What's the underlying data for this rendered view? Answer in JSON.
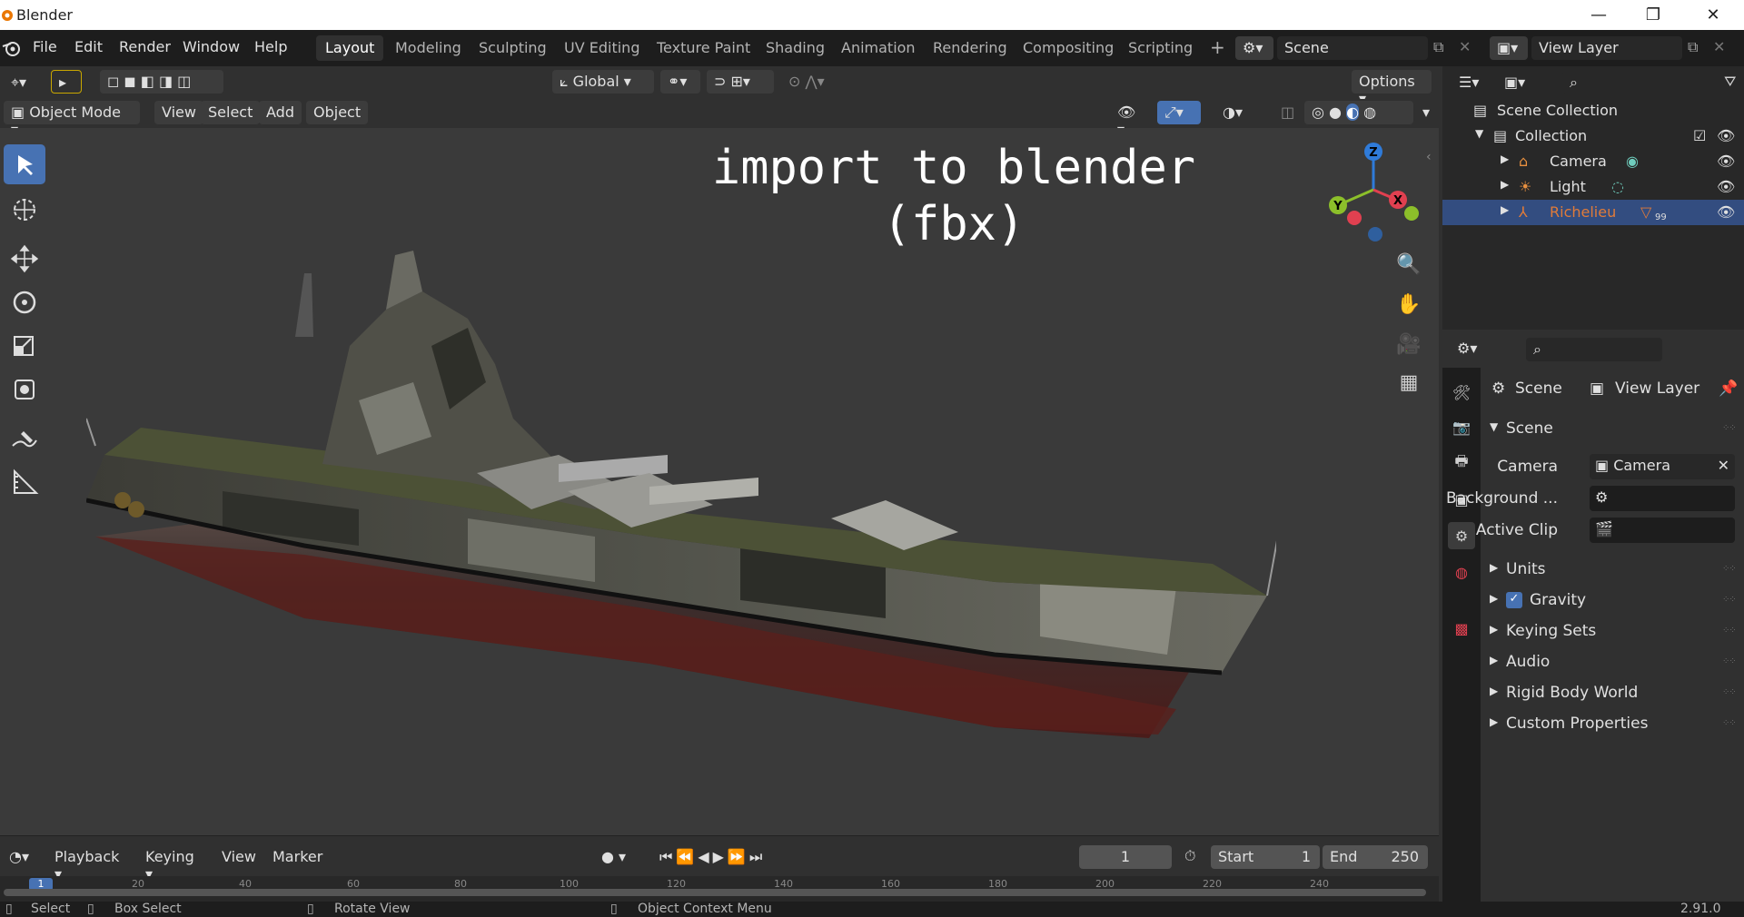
{
  "window": {
    "title": "Blender"
  },
  "menu": [
    "File",
    "Edit",
    "Render",
    "Window",
    "Help"
  ],
  "workspaces": [
    "Layout",
    "Modeling",
    "Sculpting",
    "UV Editing",
    "Texture Paint",
    "Shading",
    "Animation",
    "Rendering",
    "Compositing",
    "Scripting"
  ],
  "active_workspace": "Layout",
  "scene_field": "Scene",
  "view_layer_field": "View Layer",
  "header": {
    "transform_orientation": "Global",
    "options_label": "Options",
    "mode": "Object Mode",
    "menus": [
      "View",
      "Select",
      "Add",
      "Object"
    ]
  },
  "viewport": {
    "overlay_line1": "import to blender",
    "overlay_line2": "(fbx)",
    "gizmo": {
      "z": "Z",
      "y": "Y",
      "x": "X"
    }
  },
  "timeline": {
    "menus": [
      "Playback",
      "Keying",
      "View",
      "Marker"
    ],
    "current_frame": "1",
    "start_label": "Start",
    "start_value": "1",
    "end_label": "End",
    "end_value": "250",
    "ticks": [
      "20",
      "40",
      "60",
      "80",
      "100",
      "120",
      "140",
      "160",
      "180",
      "200",
      "220",
      "240"
    ],
    "frame_marker": "1"
  },
  "outliner": {
    "root": "Scene Collection",
    "collection": "Collection",
    "items": [
      {
        "name": "Camera",
        "color": "#e0e0e0"
      },
      {
        "name": "Light",
        "color": "#e0e0e0"
      },
      {
        "name": "Richelieu",
        "color": "#e07b39",
        "badge": "99"
      }
    ]
  },
  "properties": {
    "breadcrumb_scene": "Scene",
    "breadcrumb_view_layer": "View Layer",
    "panel_title": "Scene",
    "fields": [
      {
        "label": "Camera",
        "value": "Camera"
      },
      {
        "label": "Background ...",
        "value": ""
      },
      {
        "label": "Active Clip",
        "value": ""
      }
    ],
    "subpanels": [
      "Units",
      "Gravity",
      "Keying Sets",
      "Audio",
      "Rigid Body World",
      "Custom Properties"
    ],
    "gravity_checked": true
  },
  "statusbar": {
    "items": [
      "Select",
      "Box Select",
      "Rotate View",
      "Object Context Menu"
    ],
    "version": "2.91.0"
  },
  "colors": {
    "accent": "#4772b3",
    "selection": "#334d80",
    "richelieu": "#e07b39"
  }
}
